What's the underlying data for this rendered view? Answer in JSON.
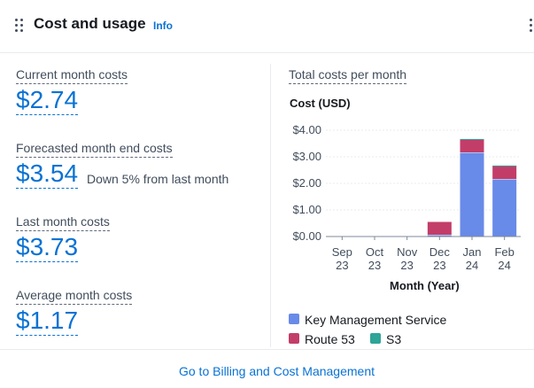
{
  "header": {
    "title": "Cost and usage",
    "info_label": "Info"
  },
  "metrics": {
    "current": {
      "label": "Current month costs",
      "value": "$2.74"
    },
    "forecast": {
      "label": "Forecasted month end costs",
      "value": "$3.54",
      "note": "Down 5% from last month"
    },
    "last_month": {
      "label": "Last month costs",
      "value": "$3.73"
    },
    "average": {
      "label": "Average month costs",
      "value": "$1.17"
    }
  },
  "chart_data": {
    "type": "bar",
    "stacked": true,
    "title": "Total costs per month",
    "ylabel": "Cost (USD)",
    "xlabel": "Month (Year)",
    "categories": [
      [
        "Sep",
        "23"
      ],
      [
        "Oct",
        "23"
      ],
      [
        "Nov",
        "23"
      ],
      [
        "Dec",
        "23"
      ],
      [
        "Jan",
        "24"
      ],
      [
        "Feb",
        "24"
      ]
    ],
    "ylim": [
      0,
      4
    ],
    "yticks": [
      "$0.00",
      "$1.00",
      "$2.00",
      "$3.00",
      "$4.00"
    ],
    "series": [
      {
        "name": "Key Management Service",
        "color": "#688ae8",
        "values": [
          0,
          0,
          0,
          0.05,
          3.15,
          2.15
        ]
      },
      {
        "name": "Route 53",
        "color": "#c33d69",
        "values": [
          0,
          0,
          0,
          0.5,
          0.5,
          0.5
        ]
      },
      {
        "name": "S3",
        "color": "#2ea597",
        "values": [
          0,
          0,
          0,
          0,
          0.02,
          0.02
        ]
      }
    ],
    "grid": true,
    "legend_position": "bottom"
  },
  "footer": {
    "link_label": "Go to Billing and Cost Management"
  }
}
